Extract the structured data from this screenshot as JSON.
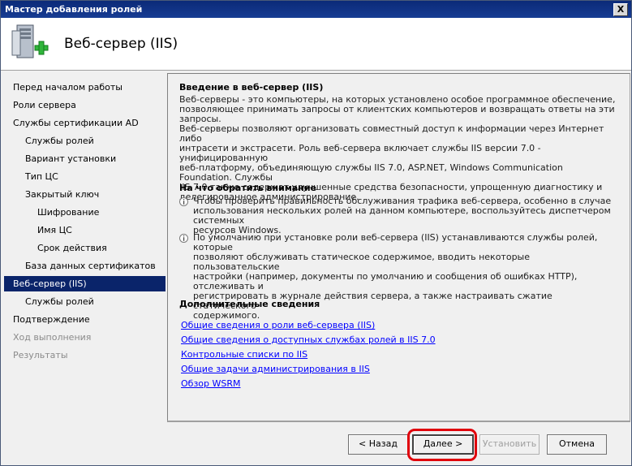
{
  "window": {
    "title": "Мастер добавления ролей",
    "close_label": "X"
  },
  "header": {
    "title": "Веб-сервер (IIS)",
    "icon": "server-add-icon"
  },
  "sidebar": {
    "items": [
      {
        "label": "Перед началом работы",
        "state": "normal",
        "level": 0
      },
      {
        "label": "Роли сервера",
        "state": "normal",
        "level": 0
      },
      {
        "label": "Службы сертификации AD",
        "state": "normal",
        "level": 0
      },
      {
        "label": "Службы ролей",
        "state": "normal",
        "level": 1
      },
      {
        "label": "Вариант установки",
        "state": "normal",
        "level": 1
      },
      {
        "label": "Тип ЦС",
        "state": "normal",
        "level": 1
      },
      {
        "label": "Закрытый ключ",
        "state": "normal",
        "level": 1
      },
      {
        "label": "Шифрование",
        "state": "normal",
        "level": 2
      },
      {
        "label": "Имя ЦС",
        "state": "normal",
        "level": 2
      },
      {
        "label": "Срок действия",
        "state": "normal",
        "level": 2
      },
      {
        "label": "База данных сертификатов",
        "state": "normal",
        "level": 1
      },
      {
        "label": "Веб-сервер (IIS)",
        "state": "active",
        "level": 0
      },
      {
        "label": "Службы ролей",
        "state": "normal",
        "level": 1
      },
      {
        "label": "Подтверждение",
        "state": "normal",
        "level": 0
      },
      {
        "label": "Ход выполнения",
        "state": "disabled",
        "level": 0
      },
      {
        "label": "Результаты",
        "state": "disabled",
        "level": 0
      }
    ]
  },
  "main": {
    "intro_heading": "Введение в веб-сервер (IIS)",
    "intro_lines": [
      "Веб-серверы - это компьютеры, на которых установлено особое программное обеспечение,",
      "позволяющее принимать запросы от клиентских компьютеров и возвращать ответы на эти запросы.",
      "Веб-серверы позволяют организовать совместный доступ к информации через Интернет либо",
      "интрасети и экстрасети. Роль веб-сервера включает службы IIS версии 7.0 - унифицированную",
      "веб-платформу, объединяющую службы IIS 7.0, ASP.NET, Windows Communication Foundation. Службы",
      "IIS 7.0 также содержат улучшенные средства безопасности, упрощенную диагностику и",
      "делегированное администрирование."
    ],
    "attention_heading": "На что обратить внимание",
    "notes": [
      {
        "icon": "info-icon",
        "lines": [
          "Чтобы проверить правильность обслуживания трафика веб-сервера, особенно в случае",
          "использования нескольких ролей на данном компьютере, воспользуйтесь диспетчером системных",
          "ресурсов Windows."
        ]
      },
      {
        "icon": "info-icon",
        "lines": [
          "По умолчанию при установке роли веб-сервера (IIS) устанавливаются службы ролей, которые",
          "позволяют обслуживать статическое содержимое, вводить некоторые пользовательские",
          "настройки (например, документы по умолчанию и сообщения об ошибках HTTP), отслеживать и",
          "регистрировать в журнале действия сервера, а также настраивать сжатие статического",
          "содержимого."
        ]
      }
    ],
    "more_heading": "Дополнительные сведения",
    "links": [
      "Общие сведения о роли веб-сервера (IIS)",
      "Общие сведения о доступных службах ролей в IIS 7.0",
      "Контрольные списки по IIS",
      "Общие задачи администрирования в IIS",
      "Обзор WSRM"
    ]
  },
  "buttons": {
    "back": "< Назад",
    "next": "Далее >",
    "install": "Установить",
    "cancel": "Отмена"
  },
  "colors": {
    "titlebar": "#0b2a78",
    "active_item": "#0a246a",
    "link": "#0000ff",
    "highlight": "#e0000b"
  }
}
